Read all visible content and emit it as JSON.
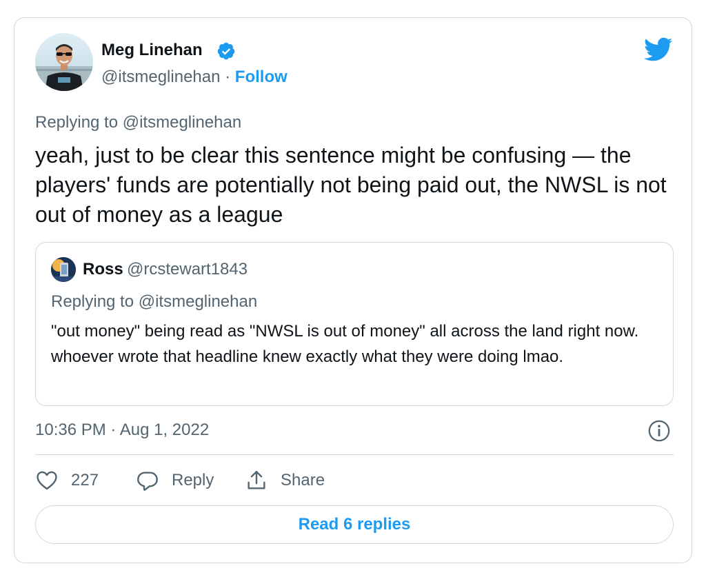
{
  "author": {
    "name": "Meg Linehan",
    "handle": "@itsmeglinehan",
    "separator": "·",
    "follow_label": "Follow"
  },
  "tweet": {
    "replying_to": "Replying to @itsmeglinehan",
    "text": "yeah, just to be clear this sentence might be confusing — the players' funds are potentially not being paid out, the NWSL is not out of money as a league",
    "timestamp": "10:36 PM · Aug 1, 2022"
  },
  "quoted": {
    "name": "Ross",
    "handle": "@rcstewart1843",
    "replying_to": "Replying to @itsmeglinehan",
    "text": "\"out money\" being read as \"NWSL is out of money\" all across the land right now. whoever wrote that headline knew exactly what they were doing lmao."
  },
  "actions": {
    "like_count": "227",
    "reply_label": "Reply",
    "share_label": "Share"
  },
  "read_replies_label": "Read 6 replies",
  "icons": [
    "verified-badge-icon",
    "twitter-bird-icon",
    "info-icon",
    "heart-icon",
    "reply-bubble-icon",
    "share-icon"
  ],
  "colors": {
    "accent": "#1d9bf0",
    "muted": "#536471",
    "text": "#0f1419",
    "border": "#cfd9de"
  }
}
